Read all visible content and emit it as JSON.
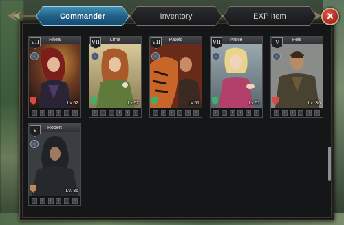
{
  "tabs": [
    {
      "label": "Commander",
      "active": true
    },
    {
      "label": "Inventory",
      "active": false
    },
    {
      "label": "EXP Item",
      "active": false
    }
  ],
  "close_icon": "close-icon",
  "commanders": [
    {
      "name": "Rhea",
      "rank": "VII",
      "level": "Lv.52",
      "badge": "red"
    },
    {
      "name": "Lima",
      "rank": "VII",
      "level": "Lv.52",
      "badge": "green"
    },
    {
      "name": "Patelo",
      "rank": "VII",
      "level": "Lv.51",
      "badge": "green"
    },
    {
      "name": "Annie",
      "rank": "VII",
      "level": "Lv.51",
      "badge": "green"
    },
    {
      "name": "Feis",
      "rank": "V",
      "level": "Lv. 36",
      "badge": "red"
    },
    {
      "name": "Robert",
      "rank": "V",
      "level": "Lv. 36",
      "badge": "tan"
    }
  ],
  "colors": {
    "accent": "#2a7aa8",
    "close": "#c0392b"
  }
}
